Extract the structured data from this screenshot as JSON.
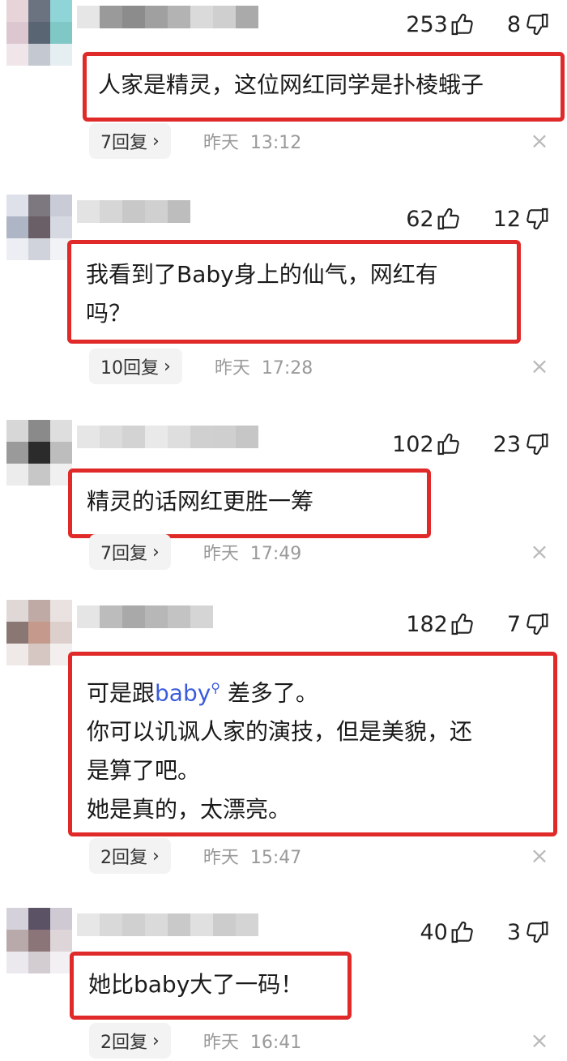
{
  "comments": [
    {
      "likes": "253",
      "dislikes": "8",
      "text_lines": [
        "人家是精灵，这位网红同学是扑棱蛾子"
      ],
      "replies": "7回复",
      "date_label": "昨天",
      "time": "13:12",
      "avatar_colors": [
        "#e6d4d8",
        "#6b7280",
        "#8fd4d6",
        "#dcc6cf",
        "#5a6573",
        "#7fc8c6",
        "#f0e6ea",
        "#c4c9d1",
        "#e5eef0"
      ],
      "name_colors": [
        "#e6e6e6",
        "#9a9a9a",
        "#8c8c8c",
        "#a0a0a0",
        "#b3b3b3",
        "#dadada",
        "#cfcfcf",
        "#aaaaaa"
      ]
    },
    {
      "likes": "62",
      "dislikes": "12",
      "text_lines": [
        "我看到了Baby身上的仙气，网红有",
        "吗？"
      ],
      "replies": "10回复",
      "date_label": "昨天",
      "time": "17:28",
      "avatar_colors": [
        "#dfe1ea",
        "#7d7780",
        "#c9ccd6",
        "#aeb5c4",
        "#6a5f66",
        "#d6d9e1",
        "#eceef3",
        "#d0d3db",
        "#f2f3f6"
      ],
      "name_colors": [
        "#e3e3e3",
        "#d6d6d6",
        "#c8c8c8",
        "#d0d0d0",
        "#bdbdbd"
      ]
    },
    {
      "likes": "102",
      "dislikes": "23",
      "text_lines": [
        "精灵的话网红更胜一筹"
      ],
      "replies": "7回复",
      "date_label": "昨天",
      "time": "17:49",
      "avatar_colors": [
        "#d7d7d7",
        "#8a8a8a",
        "#dedede",
        "#9a9a9a",
        "#2b2b2b",
        "#bdbdbd",
        "#ececec",
        "#c7c7c7",
        "#f0f0f0"
      ],
      "name_colors": [
        "#e6e6e6",
        "#dcdcdc",
        "#d3d3d3",
        "#e9e9e9",
        "#dedede",
        "#d0d0d0",
        "#cfcfcf",
        "#c6c6c6"
      ]
    },
    {
      "likes": "182",
      "dislikes": "7",
      "text_lines": [
        "可是跟",
        "你可以讥讽人家的演技，但是美貌，还",
        "是算了吧。",
        "她是真的，太漂亮。"
      ],
      "link_text": "baby",
      "link_icon": "search-icon",
      "after_link": " 差多了。",
      "replies": "2回复",
      "date_label": "昨天",
      "time": "15:47",
      "avatar_colors": [
        "#e0d8d6",
        "#bfaaa6",
        "#e9e2e0",
        "#8a7774",
        "#c59a8c",
        "#ddd0cc",
        "#efe9e7",
        "#d7c7c3",
        "#f3efee"
      ],
      "name_colors": [
        "#e5e5e5",
        "#bcbcbc",
        "#a9a9a9",
        "#b7b7b7",
        "#c3c3c3",
        "#d5d5d5"
      ]
    },
    {
      "likes": "40",
      "dislikes": "3",
      "text_lines": [
        "她比baby大了一码！"
      ],
      "replies": "2回复",
      "date_label": "昨天",
      "time": "16:41",
      "avatar_colors": [
        "#d5d1da",
        "#5c5266",
        "#cfc9d4",
        "#b8a9ab",
        "#8c7578",
        "#ddd5d8",
        "#ece9ee",
        "#d3cdd2",
        "#f2f0f3"
      ],
      "name_colors": [
        "#e7e7e7",
        "#d9d9d9",
        "#d0d0d0",
        "#dadada",
        "#c9c9c9",
        "#e0e0e0",
        "#cccccc",
        "#d4d4d4"
      ]
    }
  ],
  "icons": {
    "like": "thumbs-up-icon",
    "dislike": "thumbs-down-icon",
    "close": "close-icon",
    "chevron": "chevron-right-icon"
  },
  "colors": {
    "highlight_border": "#e02a2a",
    "link": "#3b5bdb",
    "meta_text": "#9a9a9a"
  }
}
